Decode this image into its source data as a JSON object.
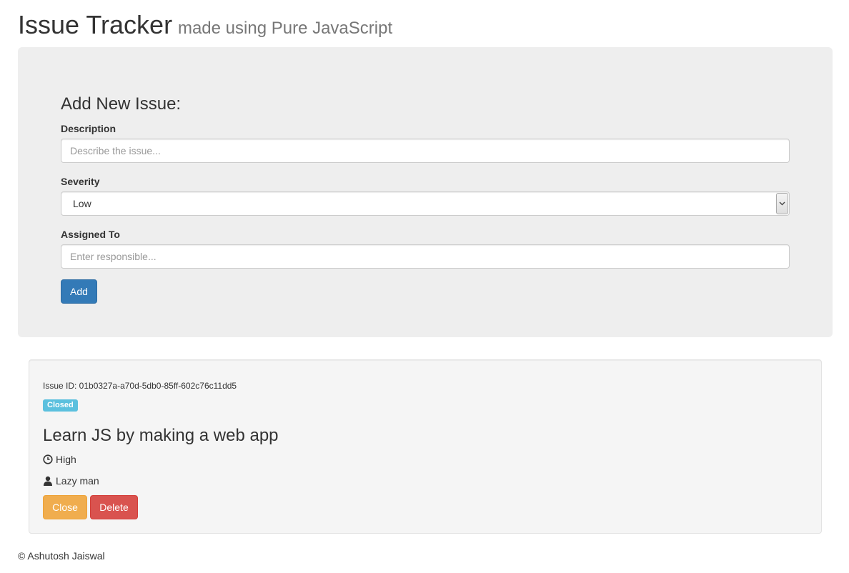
{
  "header": {
    "title": "Issue Tracker",
    "subtitle": "made using Pure JavaScript"
  },
  "form": {
    "heading": "Add New Issue:",
    "description_label": "Description",
    "description_placeholder": "Describe the issue...",
    "description_value": "",
    "severity_label": "Severity",
    "severity_value": "Low",
    "assigned_label": "Assigned To",
    "assigned_placeholder": "Enter responsible...",
    "assigned_value": "",
    "add_button": "Add"
  },
  "issues": [
    {
      "id_text": "Issue ID: 01b0327a-a70d-5db0-85ff-602c76c11dd5",
      "status": "Closed",
      "description": "Learn JS by making a web app",
      "severity": "High",
      "severity_icon": "clock-icon",
      "assigned_to": "Lazy man",
      "assigned_icon": "user-icon",
      "close_button": "Close",
      "delete_button": "Delete"
    }
  ],
  "footer": {
    "text": "© Ashutosh Jaiswal"
  },
  "colors": {
    "primary": "#337ab7",
    "warning": "#f0ad4e",
    "danger": "#d9534f",
    "info": "#5bc0de",
    "jumbotron_bg": "#eeeeee",
    "well_bg": "#f5f5f5"
  }
}
